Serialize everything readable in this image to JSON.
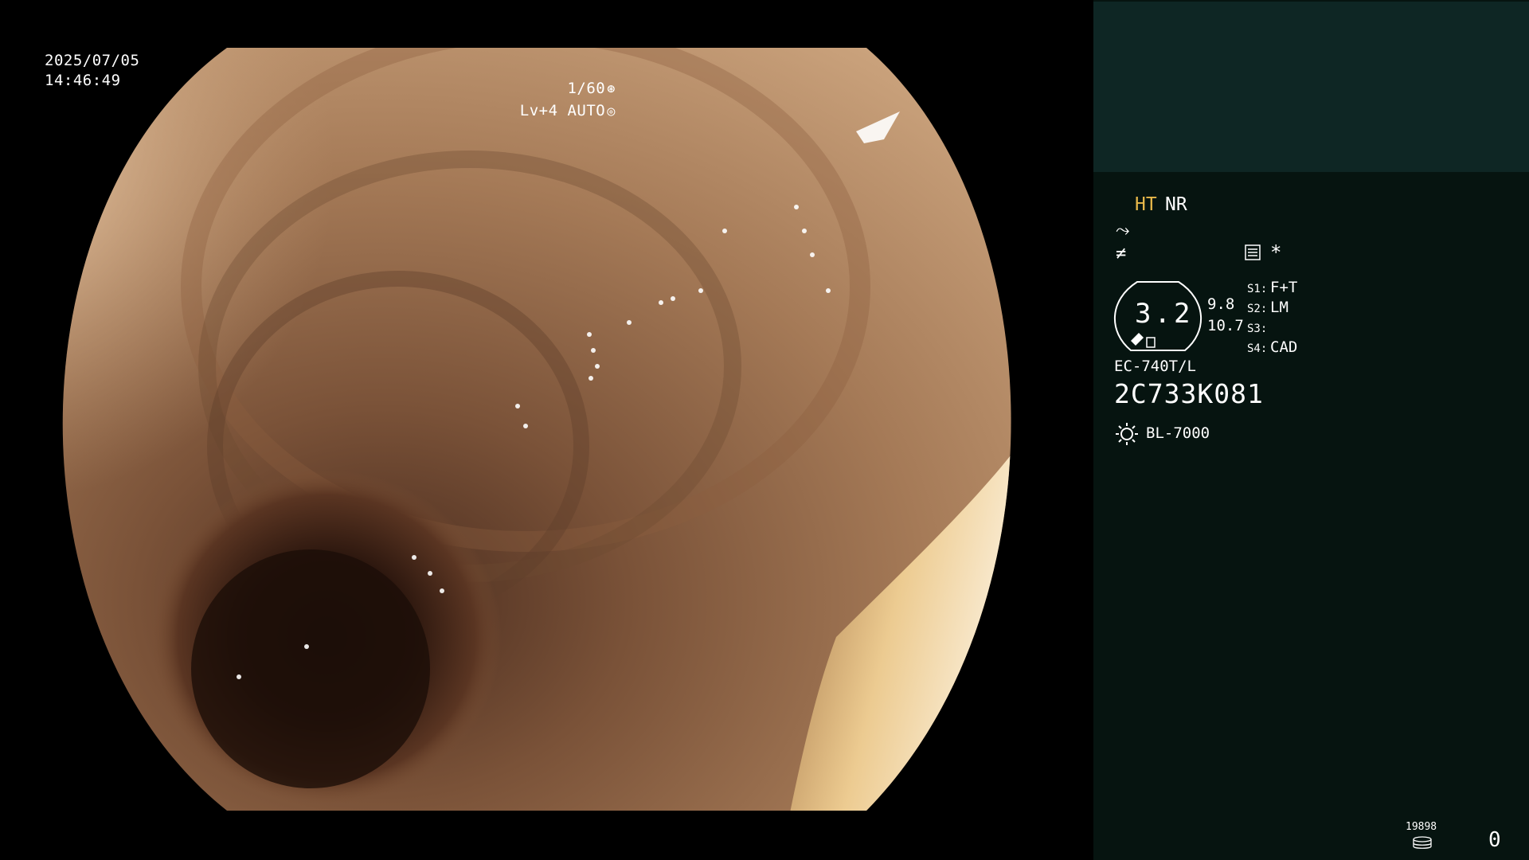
{
  "header": {
    "date": "2025/07/05",
    "time": "14:46:49",
    "shutter": "1/60",
    "shutter_icon": "aperture-icon",
    "exposure": "Lv+4 AUTO",
    "exposure_icon": "iris-icon"
  },
  "panel": {
    "ht_label": "HT",
    "nr_label": "NR",
    "enhancement_icon": "enhancement-curve-icon",
    "filter_icon": "filter-slash-icon",
    "mode_icon": "settings-list-icon",
    "mode_asterisk": "*",
    "zoom": "3.2",
    "fov_1": "9.8",
    "fov_2": "10.7",
    "switches": [
      {
        "label": "S1:",
        "value": "F+T"
      },
      {
        "label": "S2:",
        "value": "LM"
      },
      {
        "label": "S3:",
        "value": ""
      },
      {
        "label": "S4:",
        "value": "CAD"
      }
    ],
    "scope_model": "EC-740T/L",
    "scope_serial": "2C733K081",
    "light_source": "BL-7000",
    "light_icon": "light-source-icon",
    "storage_label": "19898",
    "storage_icon": "disk-icon",
    "counter": "0"
  },
  "colors": {
    "ht_accent": "#e8b84a",
    "panel_top": "#0e2624",
    "panel_bg": "#061410"
  }
}
